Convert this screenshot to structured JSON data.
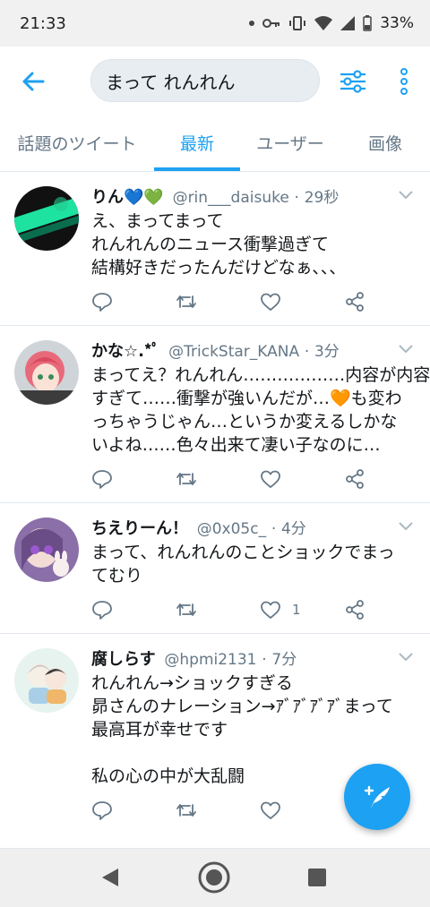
{
  "status_bar": {
    "time": "21:33",
    "battery": "33%"
  },
  "header": {
    "search_value": "まって れんれん"
  },
  "tabs": [
    {
      "label": "話題のツイート",
      "active": false
    },
    {
      "label": "最新",
      "active": true
    },
    {
      "label": "ユーザー",
      "active": false
    },
    {
      "label": "画像",
      "active": false
    }
  ],
  "tweets": [
    {
      "name": "りん💙💚",
      "handle": "@rin___daisuke",
      "time": "29秒",
      "lines": [
        "え、まってまって",
        "れんれんのニュース衝撃過ぎて",
        "結構好きだったんだけどなぁ、、、"
      ],
      "like_count": ""
    },
    {
      "name": "かな☆.*ﾟ",
      "handle": "@TrickStar_KANA",
      "time": "3分",
      "lines": [
        "まってえ？れんれん………………内容が内容",
        "すぎて……衝撃が強いんだが…🧡も変わ",
        "っちゃうじゃん…というか変えるしかな",
        "いよね……色々出来て凄い子なのに…"
      ],
      "like_count": ""
    },
    {
      "name": "ちえりーん！",
      "handle": "@0x05c_",
      "time": "4分",
      "lines": [
        "まって、れんれんのことショックでまっ",
        "てむり"
      ],
      "like_count": "1"
    },
    {
      "name": "腐しらす",
      "handle": "@hpmi2131",
      "time": "7分",
      "lines": [
        "れんれん→ショックすぎる",
        "昴さんのナレーション→ｱﾞｱﾞｱﾞｱﾞまって",
        "最高耳が幸せです",
        "",
        "私の心の中が大乱闘"
      ],
      "like_count": ""
    }
  ],
  "colors": {
    "accent": "#1da1f2",
    "secondary_text": "#657786",
    "divider": "#e1e8ed"
  }
}
